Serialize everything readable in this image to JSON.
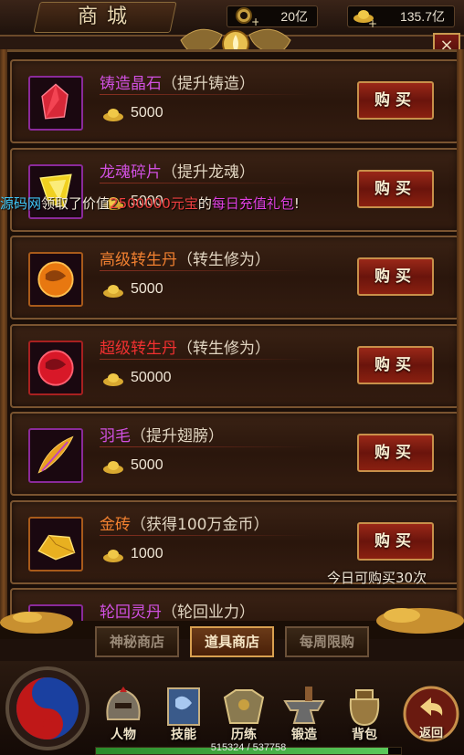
{
  "header": {
    "title": "商城",
    "currency_1": "20亿",
    "currency_2": "135.7亿",
    "close_label": "×"
  },
  "announcement": {
    "part1": "源码网",
    "part2": "领取了价值",
    "part3": "2500000元宝",
    "part4": "的",
    "part5": "每日充值礼包",
    "part6": "!"
  },
  "items": [
    {
      "name": "铸造晶石",
      "desc": "（提升铸造）",
      "price": "5000",
      "buy": "购买",
      "name_color": "#d050e0",
      "icon": "crystal-icon"
    },
    {
      "name": "龙魂碎片",
      "desc": "（提升龙魂）",
      "price": "5000",
      "buy": "购买",
      "name_color": "#d050e0",
      "icon": "dragon-soul-icon"
    },
    {
      "name": "高级转生丹",
      "desc": "（转生修为）",
      "price": "5000",
      "buy": "购买",
      "name_color": "#f08030",
      "icon": "orange-pill-icon"
    },
    {
      "name": "超级转生丹",
      "desc": "（转生修为）",
      "price": "50000",
      "buy": "购买",
      "name_color": "#f03030",
      "icon": "red-pill-icon"
    },
    {
      "name": "羽毛",
      "desc": "（提升翅膀）",
      "price": "5000",
      "buy": "购买",
      "name_color": "#d050e0",
      "icon": "feather-icon"
    },
    {
      "name": "金砖",
      "desc": "（获得100万金币）",
      "price": "1000",
      "buy": "购买",
      "name_color": "#f08030",
      "icon": "gold-brick-icon"
    },
    {
      "name": "轮回灵丹",
      "desc": "（轮回业力）",
      "price": "",
      "buy": "",
      "name_color": "#d050e0",
      "icon": "reincarnation-icon"
    }
  ],
  "limit_note": "今日可购买30次",
  "tabs": [
    {
      "label": "神秘商店",
      "active": false
    },
    {
      "label": "道具商店",
      "active": true
    },
    {
      "label": "每周限购",
      "active": false
    }
  ],
  "nav": [
    {
      "label": "人物",
      "icon": "character-helmet-icon"
    },
    {
      "label": "技能",
      "icon": "skill-book-icon"
    },
    {
      "label": "历练",
      "icon": "armor-icon"
    },
    {
      "label": "锻造",
      "icon": "anvil-icon"
    },
    {
      "label": "背包",
      "icon": "bag-icon"
    }
  ],
  "return_label": "返回",
  "exp": {
    "text": "515324 / 537758",
    "fraction": 0.958
  },
  "colors": {
    "buy_button": "#8a2010",
    "frame": "#7a5430",
    "purple_item": "#d050e0",
    "orange_item": "#f08030",
    "red_item": "#f03030"
  }
}
